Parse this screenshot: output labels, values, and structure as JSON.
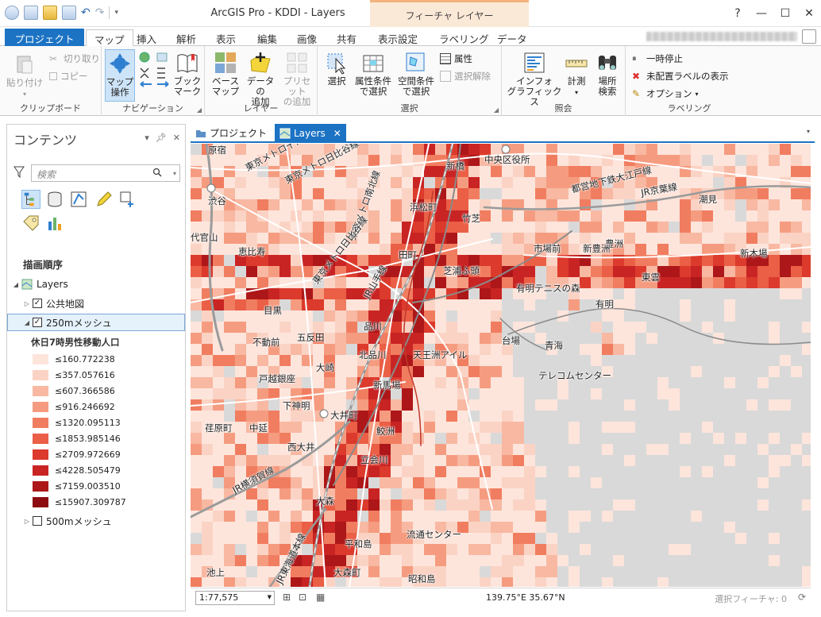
{
  "app": {
    "title": "ArcGIS Pro - KDDI - Layers",
    "contextual_group": "フィーチャ レイヤー",
    "help": "?",
    "minimize": "—",
    "maximize": "☐",
    "close": "✕"
  },
  "tabs": [
    {
      "label": "プロジェクト"
    },
    {
      "label": "マップ"
    },
    {
      "label": "挿入"
    },
    {
      "label": "解析"
    },
    {
      "label": "表示"
    },
    {
      "label": "編集"
    },
    {
      "label": "画像"
    },
    {
      "label": "共有"
    },
    {
      "label": "表示設定"
    },
    {
      "label": "ラベリング"
    },
    {
      "label": "データ"
    }
  ],
  "ribbon": {
    "clipboard": {
      "label": "クリップボード",
      "paste": "貼り付け",
      "cut": "切り取り",
      "copy": "コピー"
    },
    "navigation": {
      "label": "ナビゲーション",
      "explore": "マップ\n操作",
      "bookmarks": "ブック\nマーク"
    },
    "layer": {
      "label": "レイヤー",
      "basemap": "ベース\nマップ",
      "add_data": "データの\n追加",
      "add_preset": "プリセット\nの追加"
    },
    "selection": {
      "label": "選択",
      "select": "選択",
      "by_attr": "属性条件\nで選択",
      "by_loc": "空間条件\nで選択",
      "attributes": "属性",
      "clear": "選択解除"
    },
    "inquiry": {
      "label": "照会",
      "infographics": "インフォ\nグラフィックス",
      "measure": "計測",
      "locate": "場所\n検索"
    },
    "labeling": {
      "label": "ラベリング",
      "pause": "一時停止",
      "unplaced": "未配置ラベルの表示",
      "options": "オプション"
    }
  },
  "contents": {
    "title": "コンテンツ",
    "search_placeholder": "検索",
    "drawing_order": "描画順序",
    "tree": {
      "map": "Layers",
      "layer1": "公共地図",
      "layer2": "250mメッシュ",
      "layer3": "500mメッシュ"
    },
    "legend_title": "休日7時男性移動人口",
    "legend": [
      {
        "label": "≤160.772238",
        "color": "#fde5dc"
      },
      {
        "label": "≤357.057616",
        "color": "#fbd3c4"
      },
      {
        "label": "≤607.366586",
        "color": "#f8b8a2"
      },
      {
        "label": "≤916.246692",
        "color": "#f59c80"
      },
      {
        "label": "≤1320.095113",
        "color": "#f17d60"
      },
      {
        "label": "≤1853.985146",
        "color": "#ea5f46"
      },
      {
        "label": "≤2709.972669",
        "color": "#dc3a2c"
      },
      {
        "label": "≤4228.505479",
        "color": "#c92424"
      },
      {
        "label": "≤7159.003510",
        "color": "#ad1719"
      },
      {
        "label": "≤15907.309787",
        "color": "#8d0c12"
      }
    ]
  },
  "map_view": {
    "tab_project": "プロジェクト",
    "tab_layers": "Layers",
    "labels": [
      {
        "text": "原宿"
      },
      {
        "text": "東京メトロ千代田線"
      },
      {
        "text": "東京メトロ日比谷線"
      },
      {
        "text": "新橋"
      },
      {
        "text": "中央区役所"
      },
      {
        "text": "都営地下鉄大江戸線"
      },
      {
        "text": "JR京葉線"
      },
      {
        "text": "潮見"
      },
      {
        "text": "渋谷"
      },
      {
        "text": "浜松町"
      },
      {
        "text": "竹芝"
      },
      {
        "text": "豊洲"
      },
      {
        "text": "代官山"
      },
      {
        "text": "東京メトロ南北線"
      },
      {
        "text": "市場前"
      },
      {
        "text": "新豊洲"
      },
      {
        "text": "新木場"
      },
      {
        "text": "恵比寿"
      },
      {
        "text": "東京メトロ日比谷線"
      },
      {
        "text": "田町"
      },
      {
        "text": "芝浦ふ頭"
      },
      {
        "text": "東雲"
      },
      {
        "text": "JR山手線"
      },
      {
        "text": "有明テニスの森"
      },
      {
        "text": "目黒"
      },
      {
        "text": "有明"
      },
      {
        "text": "品川"
      },
      {
        "text": "不動前"
      },
      {
        "text": "五反田"
      },
      {
        "text": "台場"
      },
      {
        "text": "青海"
      },
      {
        "text": "北品川"
      },
      {
        "text": "天王洲アイル"
      },
      {
        "text": "大崎"
      },
      {
        "text": "戸越銀座"
      },
      {
        "text": "テレコムセンター"
      },
      {
        "text": "新馬場"
      },
      {
        "text": "下神明"
      },
      {
        "text": "大井町"
      },
      {
        "text": "荏原町"
      },
      {
        "text": "中延"
      },
      {
        "text": "鮫洲"
      },
      {
        "text": "西大井"
      },
      {
        "text": "立会川"
      },
      {
        "text": "JR横須賀線"
      },
      {
        "text": "大森"
      },
      {
        "text": "流通センター"
      },
      {
        "text": "平和島"
      },
      {
        "text": "JR東海道本線"
      },
      {
        "text": "池上"
      },
      {
        "text": "大森町"
      },
      {
        "text": "昭和島"
      }
    ]
  },
  "status": {
    "scale": "1:77,575",
    "coords": "139.75°E 35.67°N",
    "selected": "選択フィーチャ: 0"
  }
}
